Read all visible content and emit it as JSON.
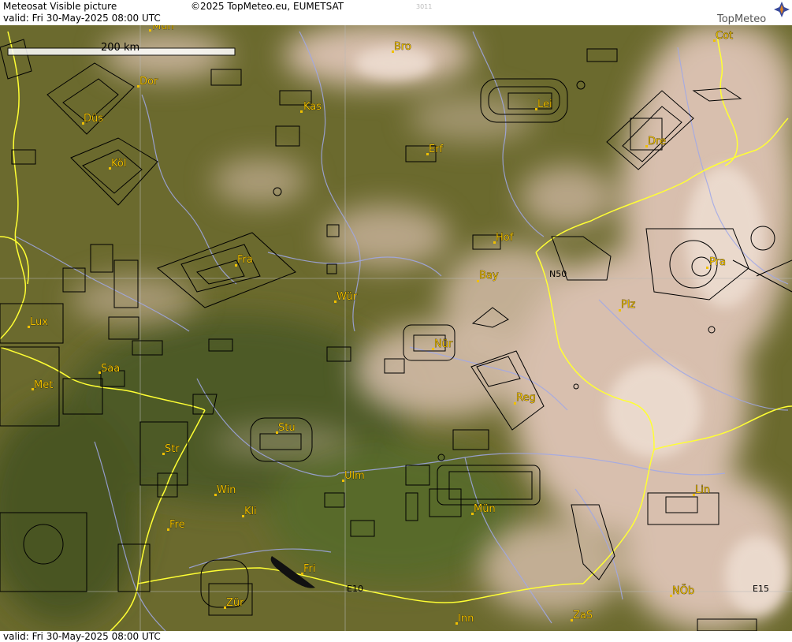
{
  "header": {
    "title": "Meteosat Visible picture",
    "valid": "valid:  Fri  30-May-2025  08:00 UTC",
    "copyright": "©2025 TopMeteo.eu, EUMETSAT",
    "code": "3011",
    "logo": "TopMeteo"
  },
  "footer": {
    "valid": "valid:  Fri  30-May-2025  08:00 UTC"
  },
  "map": {
    "scale_label": "200 km",
    "cities": [
      "Mün",
      "Bro",
      "Cot",
      "Dor",
      "Kas",
      "Lei",
      "Düs",
      "Erf",
      "Dre",
      "Köl",
      "Hof",
      "Fra",
      "Pra",
      "Bay",
      "Wür",
      "Plz",
      "Lux",
      "Nür",
      "Saa",
      "Met",
      "Reg",
      "Stu",
      "Str",
      "Ulm",
      "Win",
      "Mün",
      "Kli",
      "Lin",
      "Fre",
      "Fri",
      "Zür",
      "Inn",
      "NÖb",
      "ZaS"
    ],
    "grid_labels": {
      "n50": "N50",
      "e10": "E10",
      "e15": "E15"
    }
  },
  "colors": {
    "vegetation": "#6b6a2e",
    "cloud": "#d8bfae",
    "border": "#ffff33",
    "river": "#a0a8e8",
    "city": "#f0c000"
  }
}
